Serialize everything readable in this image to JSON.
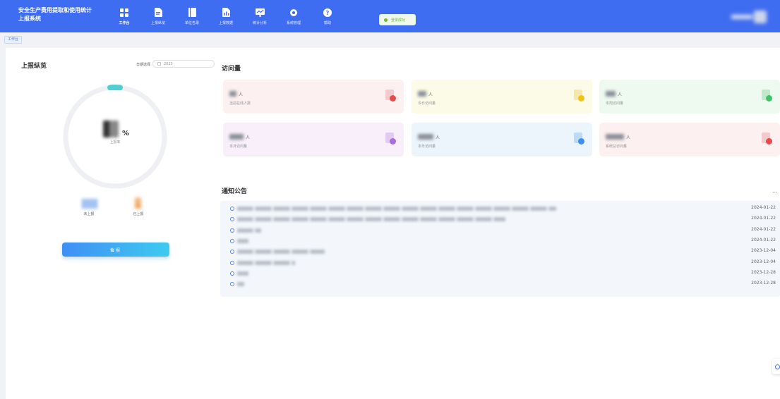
{
  "header": {
    "title_line1": "安全生产费用提取和使用统计",
    "title_line2": "上报系统",
    "nav": [
      {
        "label": "工作台",
        "icon": "dashboard-icon",
        "active": true
      },
      {
        "label": "上报纵览",
        "icon": "report-doc-icon",
        "active": false
      },
      {
        "label": "单位名录",
        "icon": "book-icon",
        "active": false
      },
      {
        "label": "上报数据",
        "icon": "data-doc-icon",
        "active": false
      },
      {
        "label": "统计分析",
        "icon": "chart-icon",
        "active": false
      },
      {
        "label": "系统管理",
        "icon": "gear-icon",
        "active": false
      },
      {
        "label": "帮助",
        "icon": "help-icon",
        "active": false
      }
    ],
    "toast": "登录成功"
  },
  "breadcrumb": {
    "tag": "工作台"
  },
  "left": {
    "title": "上报纵览",
    "date_label": "日期选择",
    "date_value": "2023",
    "percent_sign": "%",
    "percent_label": "上报率",
    "not_reported_label": "未上报",
    "reported_label": "已上报",
    "remind_button": "催报",
    "ring_progress_color": "#4ecfd0",
    "ring_track_color": "#eef0f3"
  },
  "visits": {
    "title": "访问量",
    "cards": [
      {
        "unit": "人",
        "label": "当前在线人数",
        "bg": "#fdf0f1",
        "badge": "#e84a4a",
        "paper": "#f4c9cc"
      },
      {
        "unit": "人",
        "label": "今日访问量",
        "bg": "#fbfbe8",
        "badge": "#f2c21a",
        "paper": "#f6e8a6"
      },
      {
        "unit": "人",
        "label": "本周访问量",
        "bg": "#eefaf0",
        "badge": "#3fc36a",
        "paper": "#bfe9c9"
      },
      {
        "unit": "人",
        "label": "本月访问量",
        "bg": "#f8effa",
        "badge": "#a86ee0",
        "paper": "#e2cbf3"
      },
      {
        "unit": "人",
        "label": "本年访问量",
        "bg": "#ecf5fc",
        "badge": "#3e8ef0",
        "paper": "#bcd9f6"
      },
      {
        "unit": "人",
        "label": "系统总访问量",
        "bg": "#fdf0f1",
        "badge": "#e84a4a",
        "paper": "#f4c9cc"
      }
    ]
  },
  "notices": {
    "title": "通知公告",
    "more": "...",
    "items": [
      {
        "date": "2024-01-22"
      },
      {
        "date": "2024-01-22"
      },
      {
        "date": "2024-01-22"
      },
      {
        "date": "2024-01-22"
      },
      {
        "date": "2023-12-04"
      },
      {
        "date": "2023-12-04"
      },
      {
        "date": "2023-12-28"
      },
      {
        "date": "2023-12-28"
      }
    ]
  }
}
